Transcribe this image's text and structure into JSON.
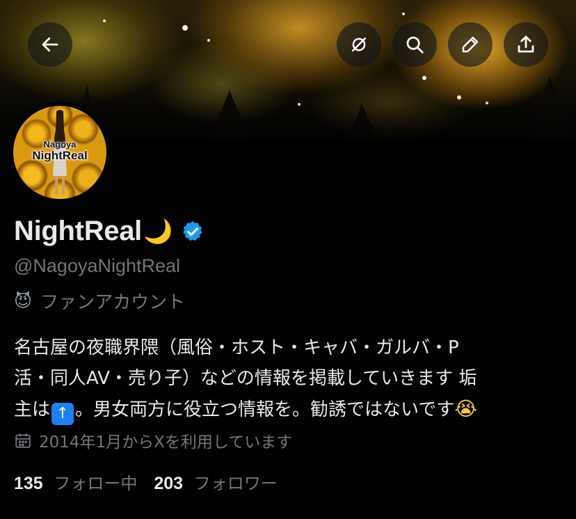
{
  "banner": {
    "description_icon": "night-autumn-trees-banner"
  },
  "toolbar": {
    "back_icon": "arrow-left-icon",
    "grok_icon": "grok-icon",
    "search_icon": "search-icon",
    "edit_icon": "pencil-icon",
    "share_icon": "share-icon"
  },
  "avatar": {
    "text_top": "Nagoya",
    "text_main": "NightReal"
  },
  "profile": {
    "name": "NightReal",
    "name_emoji": "🌙",
    "verified": true,
    "handle": "@NagoyaNightReal",
    "category_icon": "😈",
    "category": "ファンアカウント",
    "bio_line1": "名古屋の夜職界隈（風俗・ホスト・キャバ・ガルバ・P",
    "bio_line2": "活・同人AV・売り子）などの情報を掲載していきます 垢",
    "bio_line3a": "主は",
    "bio_badge": "↑",
    "bio_line3b": "。男女両方に役立つ情報を。勧誘ではないです",
    "bio_emoji": "😭",
    "joined": "2014年1月からXを利用しています",
    "following_count": "135",
    "following_label": "フォロー中",
    "followers_count": "203",
    "followers_label": "フォロワー"
  },
  "colors": {
    "accent": "#1d9bf0",
    "muted": "#71767b",
    "text": "#e7e9ea",
    "background": "#000000"
  }
}
